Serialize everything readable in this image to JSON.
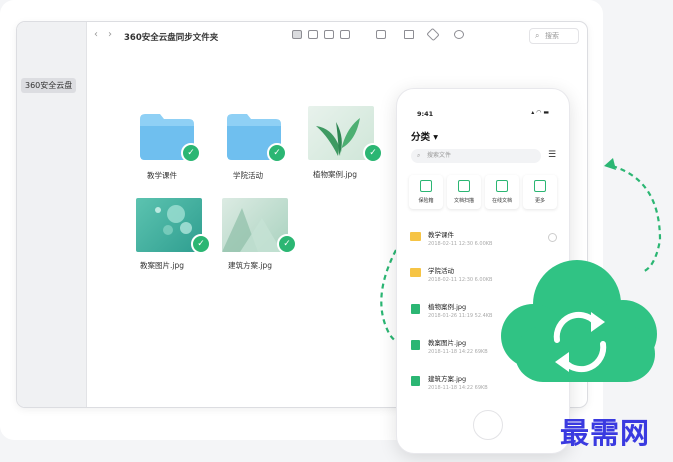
{
  "window": {
    "title": "360安全云盘同步文件夹",
    "sidebar_item": "360安全云盘",
    "search_placeholder": "搜索",
    "nav_back": "‹",
    "nav_forward": "›"
  },
  "files": [
    {
      "name": "教学课件",
      "kind": "folder",
      "synced": true
    },
    {
      "name": "学院活动",
      "kind": "folder",
      "synced": true
    },
    {
      "name": "植物案例.jpg",
      "kind": "image",
      "synced": true
    },
    {
      "name": "教案图片.jpg",
      "kind": "image",
      "synced": true
    },
    {
      "name": "建筑方案.jpg",
      "kind": "image",
      "synced": true
    }
  ],
  "phone": {
    "time": "9:41",
    "status": "▴ ◠ ▬",
    "title": "分类 ▾",
    "search_placeholder": "搜索文件",
    "actions": [
      "保险箱",
      "文档扫描",
      "在线文档",
      "更多"
    ],
    "list": [
      {
        "name": "教学课件",
        "meta": "2018-02-11 12:30  6.00KB",
        "kind": "folder"
      },
      {
        "name": "学院活动",
        "meta": "2018-02-11 12:30  6.00KB",
        "kind": "folder"
      },
      {
        "name": "植物案例.jpg",
        "meta": "2018-01-26 11:19  52.4KB",
        "kind": "image"
      },
      {
        "name": "教案图片.jpg",
        "meta": "2018-11-18 14:22  69KB",
        "kind": "image"
      },
      {
        "name": "建筑方案.jpg",
        "meta": "2018-11-18 14:22  69KB",
        "kind": "image"
      }
    ]
  },
  "watermark": "最需网",
  "colors": {
    "accent": "#2bb673",
    "folder": "#7cc4ef",
    "cloud": "#30c384",
    "watermark": "#3a3ae0"
  }
}
